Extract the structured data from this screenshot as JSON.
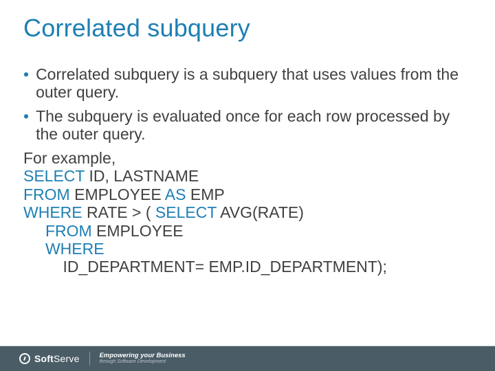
{
  "title": "Correlated subquery",
  "bullets": [
    "Correlated subquery is a subquery that uses values from the outer query.",
    "The subquery is evaluated once for each row processed by the outer query."
  ],
  "example_label": "For example,",
  "sql": {
    "l1": {
      "kw1": "SELECT",
      "rest1": " ID, LASTNAME"
    },
    "l2": {
      "kw1": "FROM",
      "rest1": " EMPLOYEE ",
      "kw2": "AS",
      "rest2": " EMP"
    },
    "l3": {
      "kw1": "WHERE",
      "rest1": " RATE > ( ",
      "kw2": "SELECT",
      "rest2": " AVG(RATE)"
    },
    "l4": {
      "indent": "     ",
      "kw1": "FROM",
      "rest1": " EMPLOYEE"
    },
    "l5": {
      "indent": "     ",
      "kw1": "WHERE"
    },
    "l6": {
      "indent": "         ",
      "rest1": "ID_DEPARTMENT= EMP.ID_DEPARTMENT);"
    }
  },
  "footer": {
    "brand_prefix": "Soft",
    "brand_suffix": "Serve",
    "tagline_main": "Empowering your Business",
    "tagline_sub": "through Software Development"
  }
}
